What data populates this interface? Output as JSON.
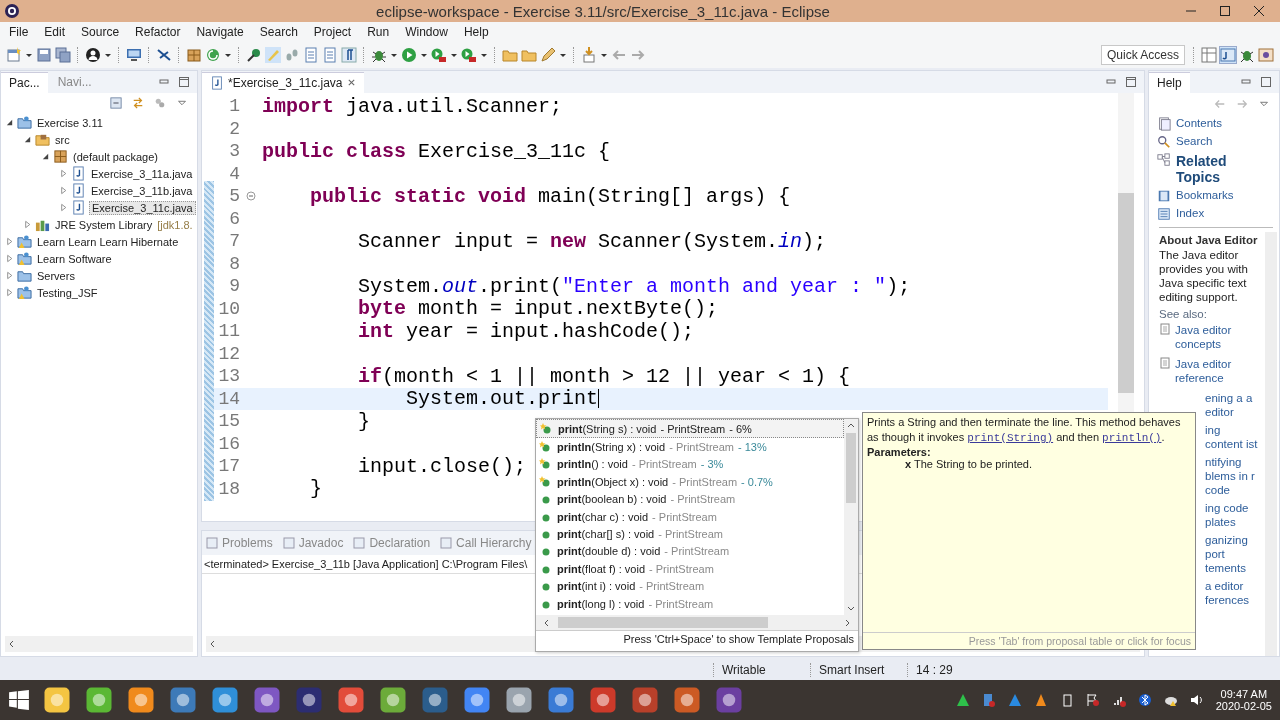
{
  "window": {
    "title": "eclipse-workspace - Exercise 3.11/src/Exercise_3_11c.java - Eclipse"
  },
  "menu": [
    "File",
    "Edit",
    "Source",
    "Refactor",
    "Navigate",
    "Search",
    "Project",
    "Run",
    "Window",
    "Help"
  ],
  "quick_access": {
    "placeholder": "Quick Access"
  },
  "left_tabs": [
    {
      "label": "Pac...",
      "selected": true
    },
    {
      "label": "Navi...",
      "selected": false
    }
  ],
  "tree": [
    {
      "label": "Exercise 3.11",
      "kind": "project",
      "expanded": true,
      "selected": false,
      "children": [
        {
          "label": "src",
          "kind": "src",
          "expanded": true,
          "selected": false,
          "children": [
            {
              "label": "(default package)",
              "kind": "package",
              "expanded": true,
              "selected": false,
              "children": [
                {
                  "label": "Exercise_3_11a.java",
                  "kind": "java",
                  "expanded": false,
                  "selected": false
                },
                {
                  "label": "Exercise_3_11b.java",
                  "kind": "java",
                  "expanded": false,
                  "selected": false
                },
                {
                  "label": "Exercise_3_11c.java",
                  "kind": "java",
                  "expanded": false,
                  "selected": true
                }
              ]
            }
          ]
        },
        {
          "label": "JRE System Library",
          "decoration": "[jdk1.8.",
          "kind": "library",
          "expanded": false,
          "selected": false
        }
      ]
    },
    {
      "label": "Learn Learn Learn Hibernate",
      "kind": "project-warn",
      "expanded": false,
      "selected": false
    },
    {
      "label": "Learn Software",
      "kind": "project-warn",
      "expanded": false,
      "selected": false
    },
    {
      "label": "Servers",
      "kind": "folder",
      "expanded": false,
      "selected": false
    },
    {
      "label": "Testing_JSF",
      "kind": "project-warn",
      "expanded": false,
      "selected": false
    }
  ],
  "editor": {
    "tabs": [
      {
        "label": "*Exercise_3_11c.java",
        "selected": true
      }
    ],
    "lines": [
      {
        "number": "1",
        "current": false,
        "fold": false,
        "parts": [
          {
            "kind": "code",
            "text": "**import** java.util.Scanner;"
          }
        ]
      },
      {
        "number": "2",
        "current": false,
        "fold": false
      },
      {
        "number": "3",
        "current": false,
        "fold": false,
        "parts": [
          {
            "kind": "code",
            "text": "**public** **class** Exercise_3_11c {"
          }
        ]
      },
      {
        "number": "4",
        "current": false,
        "fold": false
      },
      {
        "number": "5",
        "current": false,
        "fold": true,
        "parts": [
          {
            "kind": "code",
            "text": "    **public** **static** **void** main(String[] args) {"
          }
        ]
      },
      {
        "number": "6",
        "current": false,
        "fold": false
      },
      {
        "number": "7",
        "current": false,
        "fold": false,
        "parts": [
          {
            "kind": "code",
            "text": "        Scanner input = **new** Scanner(System.*in*);"
          }
        ]
      },
      {
        "number": "8",
        "current": false,
        "fold": false
      },
      {
        "number": "9",
        "current": false,
        "fold": false,
        "parts": [
          {
            "kind": "code",
            "text": "        System.*out*.print("
          },
          {
            "kind": "string",
            "text": "\"Enter a month and year : \""
          },
          {
            "kind": "code",
            "text": ");"
          }
        ]
      },
      {
        "number": "10",
        "current": false,
        "fold": false,
        "parts": [
          {
            "kind": "code",
            "text": "        **byte** month = input.nextByte();"
          }
        ]
      },
      {
        "number": "11",
        "current": false,
        "fold": false,
        "parts": [
          {
            "kind": "code",
            "text": "        **int** year = input.hashCode();"
          }
        ]
      },
      {
        "number": "12",
        "current": false,
        "fold": false
      },
      {
        "number": "13",
        "current": false,
        "fold": false,
        "parts": [
          {
            "kind": "code",
            "text": "        **if**(month < 1 || month > 12 || year < 1) {"
          }
        ]
      },
      {
        "number": "14",
        "current": true,
        "fold": false,
        "parts": [
          {
            "kind": "code",
            "text": "            System.out.print"
          }
        ]
      },
      {
        "number": "15",
        "current": false,
        "fold": false,
        "parts": [
          {
            "kind": "code",
            "text": "        }"
          }
        ]
      },
      {
        "number": "16",
        "current": false,
        "fold": false
      },
      {
        "number": "17",
        "current": false,
        "fold": false,
        "parts": [
          {
            "kind": "code",
            "text": "        input.close();"
          }
        ]
      },
      {
        "number": "18",
        "current": false,
        "fold": false,
        "parts": [
          {
            "kind": "code",
            "text": "    }"
          }
        ]
      }
    ]
  },
  "bottom_tabs": [
    "Problems",
    "Javadoc",
    "Declaration",
    "Call Hierarchy"
  ],
  "console": {
    "text": "<terminated> Exercise_3_11b [Java Application] C:\\Program Files\\"
  },
  "help": {
    "tab": "Help",
    "nav": [
      {
        "label": "Contents",
        "kind": "contents",
        "selected": false
      },
      {
        "label": "Search",
        "kind": "search",
        "selected": false
      },
      {
        "label": "Related Topics",
        "kind": "related",
        "selected": true
      },
      {
        "label": "Bookmarks",
        "kind": "bookmarks",
        "selected": false
      },
      {
        "label": "Index",
        "kind": "index",
        "selected": false
      }
    ],
    "about_title": "About Java Editor",
    "about_text": "The Java editor provides you with Java specific text editing support.",
    "see_also": "See also:",
    "links": [
      "Java editor concepts",
      "Java editor reference"
    ],
    "covered_links": [
      "ening a a editor",
      "ing content ist",
      "ntifying blems in r code",
      "ing code plates",
      "ganizing port tements",
      "a editor ferences"
    ]
  },
  "proposals": [
    {
      "name": "print",
      "sig": "(String s) : void",
      "owner": "- PrintStream",
      "relevance": "- 6%",
      "starred": true,
      "selected": true
    },
    {
      "name": "println",
      "sig": "(String x) : void",
      "owner": "- PrintStream",
      "relevance": "- 13%",
      "starred": true,
      "selected": false
    },
    {
      "name": "println",
      "sig": "() : void",
      "owner": "- PrintStream",
      "relevance": "- 3%",
      "starred": true,
      "selected": false
    },
    {
      "name": "println",
      "sig": "(Object x) : void",
      "owner": "- PrintStream",
      "relevance": "- 0.7%",
      "starred": true,
      "selected": false
    },
    {
      "name": "print",
      "sig": "(boolean b) : void",
      "owner": "- PrintStream",
      "starred": false,
      "selected": false
    },
    {
      "name": "print",
      "sig": "(char c) : void",
      "owner": "- PrintStream",
      "starred": false,
      "selected": false
    },
    {
      "name": "print",
      "sig": "(char[] s) : void",
      "owner": "- PrintStream",
      "starred": false,
      "selected": false
    },
    {
      "name": "print",
      "sig": "(double d) : void",
      "owner": "- PrintStream",
      "starred": false,
      "selected": false
    },
    {
      "name": "print",
      "sig": "(float f) : void",
      "owner": "- PrintStream",
      "starred": false,
      "selected": false
    },
    {
      "name": "print",
      "sig": "(int i) : void",
      "owner": "- PrintStream",
      "starred": false,
      "selected": false
    },
    {
      "name": "print",
      "sig": "(long l) : void",
      "owner": "- PrintStream",
      "starred": false,
      "selected": false
    }
  ],
  "proposals_footer": "Press 'Ctrl+Space' to show Template Proposals",
  "javadoc": {
    "parts": [
      {
        "kind": "text",
        "text": "Prints a String and then terminate the line. This method behaves as though it invokes "
      },
      {
        "kind": "link",
        "text": "print(String)"
      },
      {
        "kind": "text",
        "text": " and then "
      },
      {
        "kind": "link",
        "text": "println()"
      },
      {
        "kind": "text",
        "text": "."
      }
    ],
    "params_title": "Parameters:",
    "param": "**x** The String to be printed.",
    "footer": "Press 'Tab' from proposal table or click for focus"
  },
  "status": {
    "writable": "Writable",
    "insert_mode": "Smart Insert",
    "position": "14 : 29"
  },
  "clock": {
    "time": "09:47 AM",
    "date": "2020-02-05"
  }
}
